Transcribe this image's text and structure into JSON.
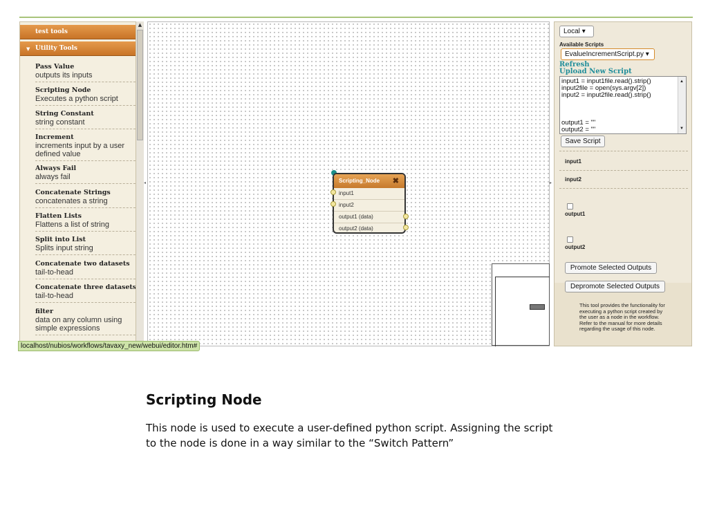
{
  "sidebar": {
    "categories": [
      "test tools",
      "Utility Tools"
    ],
    "tools": [
      {
        "title": "Pass Value",
        "desc": "outputs its inputs"
      },
      {
        "title": "Scripting Node",
        "desc": "Executes a python script"
      },
      {
        "title": "String Constant",
        "desc": "string constant"
      },
      {
        "title": "Increment",
        "desc": "increments input by a user defined value"
      },
      {
        "title": "Always Fail",
        "desc": "always fail"
      },
      {
        "title": "Concatenate Strings",
        "desc": "concatenates a string"
      },
      {
        "title": "Flatten Lists",
        "desc": "Flattens a list of string"
      },
      {
        "title": "Split into List",
        "desc": "Splits input string"
      },
      {
        "title": "Concatenate two datasets",
        "desc": "tail-to-head"
      },
      {
        "title": "Concatenate three datasets",
        "desc": "tail-to-head"
      },
      {
        "title": "filter",
        "desc": "data on any column using simple expressions"
      }
    ]
  },
  "node": {
    "title": "Scripting_Node",
    "close_glyph": "✖",
    "ports": [
      "input1",
      "input2",
      "output1 (data)",
      "output2 (data)"
    ]
  },
  "panel": {
    "location_select": "Local",
    "available_scripts_label": "Available Scripts",
    "script_select": "EvalueIncrementScript.py",
    "refresh_link": "Refresh",
    "upload_link": "Upload New Script",
    "script_text": "input1 = input1file.read().strip()\ninput2file = open(sys.argv[2])\ninput2 = input2file.read().strip()\n\n\n\noutput1 = \"\"\noutput2 = \"\"",
    "save_button": "Save Script",
    "input1_label": "input1",
    "input2_label": "input2",
    "output1_label": "output1",
    "output2_label": "output2",
    "promote_button": "Promote Selected Outputs",
    "depromote_button": "Depromote Selected Outputs",
    "help_text": "This tool provides the functionality for executing a python script created by the user as a node in the workflow. Refer to the manual for more details regarding the usage of this node."
  },
  "status_bar": "localhost/nubios/workflows/tavaxy_new/webui/editor.htm#",
  "slide": {
    "title": "Scripting Node",
    "body": "This node is used to execute a user-defined python script. Assigning the script to the node is done in a way similar to the “Switch Pattern”"
  }
}
